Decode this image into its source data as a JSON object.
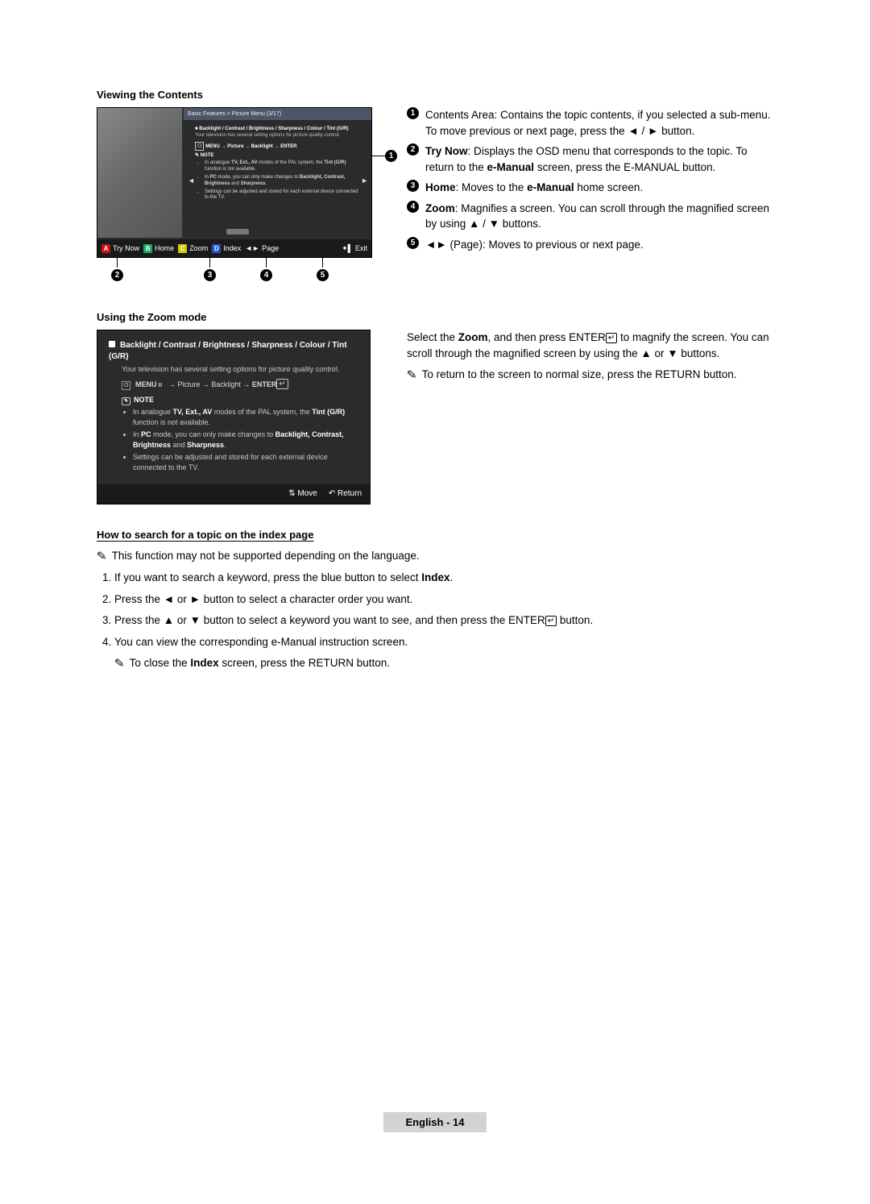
{
  "section1_title": "Viewing the Contents",
  "screenshot1": {
    "breadcrumb": "Basic Features > Picture Menu (3/17)",
    "topic_title": "Backlight / Contrast / Brightness / Sharpness / Colour / Tint (G/R)",
    "topic_sub": "Your television has several setting options for picture quality control.",
    "menu_path": "MENU → Picture → Backlight → ENTER",
    "note_label": "NOTE",
    "note1_a": "In analogue ",
    "note1_b": "TV, Ext., AV",
    "note1_c": " modes of the PAL system, the ",
    "note1_d": "Tint (G/R)",
    "note1_e": " function is not available.",
    "note2_a": "In ",
    "note2_b": "PC",
    "note2_c": " mode, you can only make changes to ",
    "note2_d": "Backlight, Contrast, Brightness",
    "note2_e": " and ",
    "note2_f": "Sharpness",
    "note2_g": ".",
    "note3": "Settings can be adjusted and stored for each external device connected to the TV.",
    "footer_try": "Try Now",
    "footer_home": "Home",
    "footer_zoom": "Zoom",
    "footer_index": "Index",
    "footer_page": "Page",
    "footer_exit": "Exit"
  },
  "callouts": {
    "n1": "1",
    "n2": "2",
    "n3": "3",
    "n4": "4",
    "n5": "5"
  },
  "desc": {
    "d1": "Contents Area: Contains the topic contents, if you selected a sub-menu. To move previous or next page, press the ◄ / ► button.",
    "d2_label": "Try Now",
    "d2_a": ": Displays the OSD menu that corresponds to the topic. To return to the ",
    "d2_b": "e-Manual",
    "d2_c": " screen, press the ",
    "d2_d": "E-MANUAL",
    "d2_e": " button.",
    "d3_label": "Home",
    "d3_a": ": Moves to the ",
    "d3_b": "e-Manual",
    "d3_c": " home screen.",
    "d4_label": "Zoom",
    "d4_a": ": Magnifies a screen. You can scroll through the magnified screen by using ▲ / ▼ buttons.",
    "d5_a": "◄► ",
    "d5_b": "(Page)",
    "d5_c": ": Moves to previous or next page."
  },
  "section2_title": "Using the Zoom mode",
  "zoom_text": {
    "p1_a": "Select the ",
    "p1_b": "Zoom",
    "p1_c": ", and then press ",
    "p1_d": "ENTER",
    "p1_e": " to magnify the screen. You can scroll through the magnified screen by using the ▲ or ▼ buttons.",
    "n1_a": "To return to the screen to normal size, press the ",
    "n1_b": "RETURN",
    "n1_c": " button."
  },
  "screenshot2": {
    "title": "Backlight / Contrast / Brightness / Sharpness / Colour / Tint (G/R)",
    "sub": "Your television has several setting options for picture quality control.",
    "menu_path_a": "MENU",
    "menu_path_b": "→ Picture → Backlight → ",
    "menu_path_c": "ENTER",
    "note_label": "NOTE",
    "b1_a": "In analogue ",
    "b1_b": "TV, Ext., AV",
    "b1_c": " modes of the PAL system, the ",
    "b1_d": "Tint (G/R)",
    "b1_e": " function is not available.",
    "b2_a": "In ",
    "b2_b": "PC",
    "b2_c": " mode, you can only make changes to ",
    "b2_d": "Backlight, Contrast, Brightness",
    "b2_e": " and ",
    "b2_f": "Sharpness",
    "b2_g": ".",
    "b3": "Settings can be adjusted and stored for each external device connected to the TV.",
    "footer_move": "Move",
    "footer_return": "Return"
  },
  "section3_title": "How to search for a topic on the index page",
  "index_note": "This function may not be supported depending on the language.",
  "steps": {
    "s1_a": "If you want to search a keyword, press the blue button to select ",
    "s1_b": "Index",
    "s1_c": ".",
    "s2": "Press the ◄ or ► button to select a character order you want.",
    "s3_a": "Press the ▲ or ▼ button to select a keyword you want to see, and then press the ",
    "s3_b": "ENTER",
    "s3_c": " button.",
    "s4": "You can view the corresponding e-Manual instruction screen.",
    "s4n_a": "To close the ",
    "s4n_b": "Index",
    "s4n_c": " screen, press the ",
    "s4n_d": "RETURN",
    "s4n_e": " button."
  },
  "footer": "English - 14"
}
